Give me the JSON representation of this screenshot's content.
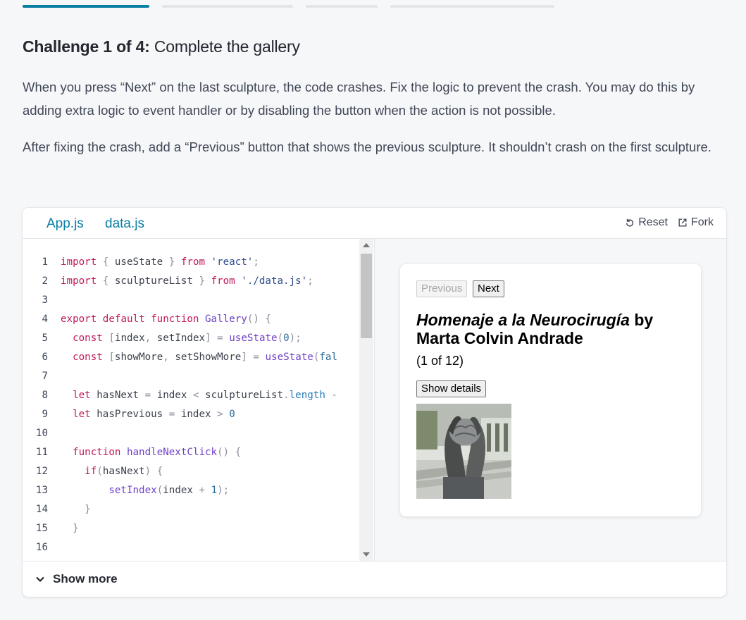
{
  "progress": {
    "total": 4,
    "current": 1
  },
  "challenge": {
    "counter": "Challenge 1 of 4:",
    "name": "Complete the gallery",
    "paragraph1": "When you press “Next” on the last sculpture, the code crashes. Fix the logic to prevent the crash. You may do this by adding extra logic to event handler or by disabling the button when the action is not possible.",
    "paragraph2": "After fixing the crash, add a “Previous” button that shows the previous sculpture. It shouldn’t crash on the first sculpture."
  },
  "sandbox": {
    "tabs": [
      "App.js",
      "data.js"
    ],
    "reset_label": "Reset",
    "fork_label": "Fork",
    "show_more_label": "Show more"
  },
  "code_lines": [
    [
      [
        "kw",
        "import"
      ],
      [
        "pu",
        " { "
      ],
      [
        "id",
        "useState"
      ],
      [
        "pu",
        " } "
      ],
      [
        "kw",
        "from"
      ],
      [
        "str",
        " 'react'"
      ],
      [
        "pu",
        ";"
      ]
    ],
    [
      [
        "kw",
        "import"
      ],
      [
        "pu",
        " { "
      ],
      [
        "id",
        "sculptureList"
      ],
      [
        "pu",
        " } "
      ],
      [
        "kw",
        "from"
      ],
      [
        "str",
        " './data.js'"
      ],
      [
        "pu",
        ";"
      ]
    ],
    [],
    [
      [
        "kw",
        "export default function"
      ],
      [
        "fn",
        " Gallery"
      ],
      [
        "pu",
        "() {"
      ]
    ],
    [
      [
        "pu",
        "  "
      ],
      [
        "kw",
        "const"
      ],
      [
        "pu",
        " ["
      ],
      [
        "id",
        "index"
      ],
      [
        "pu",
        ", "
      ],
      [
        "id",
        "setIndex"
      ],
      [
        "pu",
        "] = "
      ],
      [
        "fn",
        "useState"
      ],
      [
        "pu",
        "("
      ],
      [
        "num",
        "0"
      ],
      [
        "pu",
        ");"
      ]
    ],
    [
      [
        "pu",
        "  "
      ],
      [
        "kw",
        "const"
      ],
      [
        "pu",
        " ["
      ],
      [
        "id",
        "showMore"
      ],
      [
        "pu",
        ", "
      ],
      [
        "id",
        "setShowMore"
      ],
      [
        "pu",
        "] = "
      ],
      [
        "fn",
        "useState"
      ],
      [
        "pu",
        "("
      ],
      [
        "num",
        "fal"
      ]
    ],
    [],
    [
      [
        "pu",
        "  "
      ],
      [
        "kw",
        "let"
      ],
      [
        "id",
        " hasNext"
      ],
      [
        "pu",
        " = "
      ],
      [
        "id",
        "index"
      ],
      [
        "pu",
        " < "
      ],
      [
        "id",
        "sculptureList"
      ],
      [
        "pu",
        "."
      ],
      [
        "prop",
        "length"
      ],
      [
        "pu",
        " -"
      ]
    ],
    [
      [
        "pu",
        "  "
      ],
      [
        "kw",
        "let"
      ],
      [
        "id",
        " hasPrevious"
      ],
      [
        "pu",
        " = "
      ],
      [
        "id",
        "index"
      ],
      [
        "pu",
        " > "
      ],
      [
        "num",
        "0"
      ]
    ],
    [],
    [
      [
        "pu",
        "  "
      ],
      [
        "kw",
        "function"
      ],
      [
        "fn",
        " handleNextClick"
      ],
      [
        "pu",
        "() {"
      ]
    ],
    [
      [
        "pu",
        "    "
      ],
      [
        "kw",
        "if"
      ],
      [
        "pu",
        "("
      ],
      [
        "id",
        "hasNext"
      ],
      [
        "pu",
        ") {"
      ]
    ],
    [
      [
        "pu",
        "        "
      ],
      [
        "fn",
        "setIndex"
      ],
      [
        "pu",
        "("
      ],
      [
        "id",
        "index"
      ],
      [
        "pu",
        " + "
      ],
      [
        "num",
        "1"
      ],
      [
        "pu",
        ");"
      ]
    ],
    [
      [
        "pu",
        "    }"
      ]
    ],
    [
      [
        "pu",
        "  }"
      ]
    ],
    []
  ],
  "preview": {
    "previous_label": "Previous",
    "next_label": "Next",
    "sculpture_name": "Homenaje a la Neurocirugía",
    "by": " by ",
    "artist": "Marta Colvin Andrade",
    "counter": "(1 of 12)",
    "details_label": "Show details",
    "image_alt": "sculpture-photo"
  },
  "colors": {
    "accent": "#087ea4",
    "keyword": "#c2185b",
    "function": "#6e40c9"
  }
}
